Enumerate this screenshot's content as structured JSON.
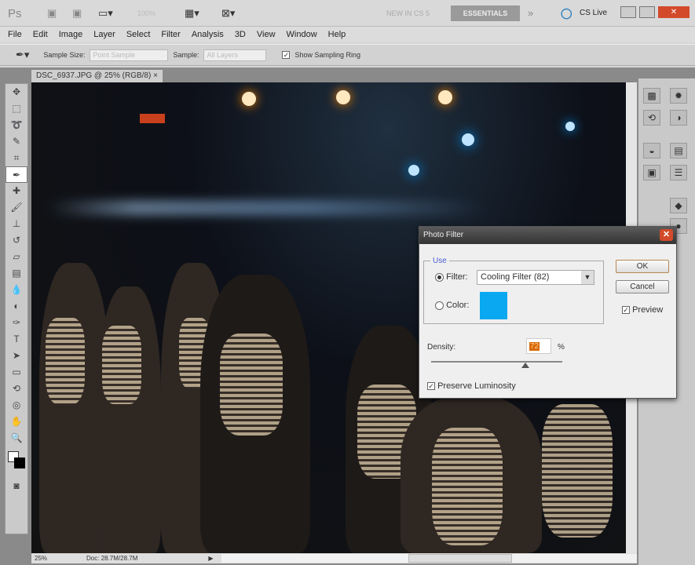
{
  "appbar": {
    "logo": "Ps",
    "zoom": "100%",
    "new_in": "NEW IN CS 5",
    "workspace": "ESSENTIALS",
    "more": "»",
    "cslive": "CS Live"
  },
  "menu": [
    "File",
    "Edit",
    "Image",
    "Layer",
    "Select",
    "Filter",
    "Analysis",
    "3D",
    "View",
    "Window",
    "Help"
  ],
  "options": {
    "sample_size_label": "Sample Size:",
    "sample_size_value": "Point Sample",
    "sample_label": "Sample:",
    "sample_value": "All Layers",
    "show_ring": "Show Sampling Ring"
  },
  "document": {
    "tab": "DSC_6937.JPG @ 25% (RGB/8)",
    "close": "×"
  },
  "status": {
    "zoom": "25%",
    "doc": "Doc: 28.7M/28.7M"
  },
  "dialog": {
    "title": "Photo Filter",
    "use_label": "Use",
    "filter_label": "Filter:",
    "filter_value": "Cooling Filter (82)",
    "color_label": "Color:",
    "swatch_color": "#0aa8f0",
    "density_label": "Density:",
    "density_value": "72",
    "density_unit": "%",
    "density_percent": 72,
    "preserve": "Preserve Luminosity",
    "ok": "OK",
    "cancel": "Cancel",
    "preview": "Preview"
  }
}
